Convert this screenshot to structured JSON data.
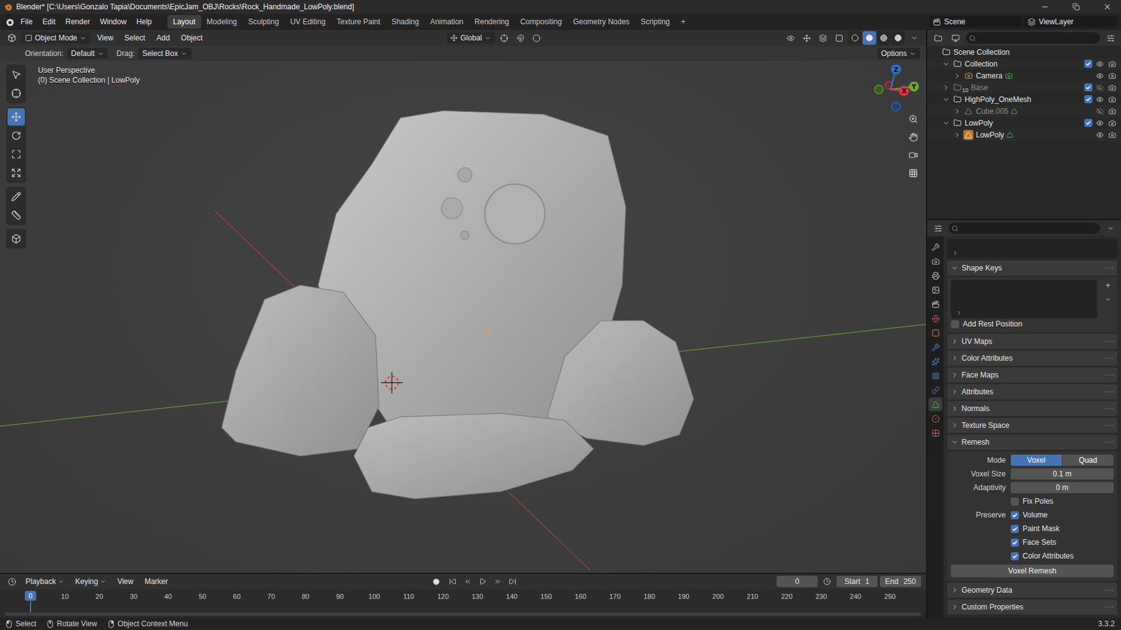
{
  "window": {
    "title": "Blender* [C:\\Users\\Gonzalo Tapia\\Documents\\EpicJam_OBJ\\Rocks\\Rock_Handmade_LowPoly.blend]"
  },
  "menu": [
    "File",
    "Edit",
    "Render",
    "Window",
    "Help"
  ],
  "workspaces": [
    {
      "label": "Layout",
      "selected": true
    },
    {
      "label": "Modeling",
      "selected": false
    },
    {
      "label": "Sculpting",
      "selected": false
    },
    {
      "label": "UV Editing",
      "selected": false
    },
    {
      "label": "Texture Paint",
      "selected": false
    },
    {
      "label": "Shading",
      "selected": false
    },
    {
      "label": "Animation",
      "selected": false
    },
    {
      "label": "Rendering",
      "selected": false
    },
    {
      "label": "Compositing",
      "selected": false
    },
    {
      "label": "Geometry Nodes",
      "selected": false
    },
    {
      "label": "Scripting",
      "selected": false
    }
  ],
  "add_workspace": "+",
  "scene": "Scene",
  "view_layer": "ViewLayer",
  "viewport": {
    "mode": "Object Mode",
    "menus": [
      "View",
      "Select",
      "Add",
      "Object"
    ],
    "transform_orientation": "Global",
    "shading_modes": [
      {
        "kind": "wireframe",
        "selected": false
      },
      {
        "kind": "solid",
        "selected": true
      },
      {
        "kind": "material",
        "selected": false
      },
      {
        "kind": "rendered",
        "selected": false
      }
    ],
    "orientation_label": "Orientation:",
    "orientation": "Default",
    "drag_label": "Drag:",
    "drag": "Select Box",
    "options": "Options",
    "overlay_title": "User Perspective",
    "overlay_subtitle": "(0) Scene Collection | LowPoly",
    "tools": [
      {
        "kind": "select",
        "selected": false,
        "group": 1
      },
      {
        "kind": "cursor",
        "selected": false,
        "group": 1
      },
      {
        "kind": "move",
        "selected": true,
        "group": 2
      },
      {
        "kind": "rotate",
        "selected": false,
        "group": 2
      },
      {
        "kind": "scale",
        "selected": false,
        "group": 2
      },
      {
        "kind": "transform",
        "selected": false,
        "group": 2
      },
      {
        "kind": "annotate",
        "selected": false,
        "group": 3
      },
      {
        "kind": "measure",
        "selected": false,
        "group": 3
      },
      {
        "kind": "add_cube",
        "selected": false,
        "group": 4
      }
    ],
    "gizmo_axes": [
      {
        "label": "Z",
        "color": "#2f6fd6"
      },
      {
        "label": "Y",
        "color": "#6fa82c"
      },
      {
        "label": "X",
        "color": "#e0344a"
      }
    ]
  },
  "outliner": {
    "rows": [
      {
        "label": "Scene Collection",
        "depth": 0,
        "kind": "scene",
        "dimmed": false,
        "active": false
      },
      {
        "label": "Collection",
        "depth": 1,
        "kind": "collection",
        "expanded": true,
        "dimmed": false,
        "checked": true,
        "visible": true,
        "active": false
      },
      {
        "label": "Camera",
        "depth": 2,
        "kind": "camera",
        "expanded": false,
        "dimmed": false,
        "visible": true,
        "active": false
      },
      {
        "label": "Base",
        "depth": 1,
        "kind": "collection",
        "expanded": false,
        "dimmed": true,
        "checked": true,
        "visible": false,
        "badge": "10",
        "active": false
      },
      {
        "label": "HighPoly_OneMesh",
        "depth": 1,
        "kind": "collection",
        "expanded": true,
        "dimmed": false,
        "checked": true,
        "visible": true,
        "active": false
      },
      {
        "label": "Cube.005",
        "depth": 2,
        "kind": "mesh",
        "expanded": false,
        "dimmed": true,
        "visible": false,
        "active": false
      },
      {
        "label": "LowPoly",
        "depth": 1,
        "kind": "collection",
        "expanded": true,
        "dimmed": false,
        "checked": true,
        "visible": true,
        "active": false
      },
      {
        "label": "LowPoly",
        "depth": 2,
        "kind": "mesh",
        "expanded": false,
        "dimmed": false,
        "visible": true,
        "active": true
      }
    ]
  },
  "properties": {
    "tabs": [
      {
        "kind": "tool",
        "selected": false
      },
      {
        "kind": "render",
        "selected": false
      },
      {
        "kind": "output",
        "selected": false
      },
      {
        "kind": "view_layer",
        "selected": false
      },
      {
        "kind": "scene",
        "selected": false
      },
      {
        "kind": "world",
        "selected": false
      },
      {
        "kind": "object",
        "selected": false
      },
      {
        "kind": "modifiers",
        "selected": false
      },
      {
        "kind": "particles",
        "selected": false
      },
      {
        "kind": "physics",
        "selected": false
      },
      {
        "kind": "constraints",
        "selected": false
      },
      {
        "kind": "data",
        "selected": true
      },
      {
        "kind": "material",
        "selected": false
      },
      {
        "kind": "texture",
        "selected": false
      }
    ],
    "shape_keys": {
      "label": "Shape Keys",
      "expanded": true,
      "add_button": "+",
      "add_rest_position": {
        "label": "Add Rest Position",
        "checked": false
      }
    },
    "collapsed_panels": [
      {
        "label": "UV Maps",
        "expanded": false
      },
      {
        "label": "Color Attributes",
        "expanded": false
      },
      {
        "label": "Face Maps",
        "expanded": false
      },
      {
        "label": "Attributes",
        "expanded": false
      },
      {
        "label": "Normals",
        "expanded": false
      },
      {
        "label": "Texture Space",
        "expanded": false
      }
    ],
    "remesh": {
      "label": "Remesh",
      "expanded": true,
      "mode_label": "Mode",
      "modes": [
        {
          "label": "Voxel",
          "selected": true
        },
        {
          "label": "Quad",
          "selected": false
        }
      ],
      "fields": [
        {
          "label": "Voxel Size",
          "value": "0.1 m"
        },
        {
          "label": "Adaptivity",
          "value": "0 m"
        }
      ],
      "fix_poles": {
        "label": "Fix Poles",
        "checked": false
      },
      "preserve_label": "Preserve",
      "preserve": [
        {
          "label": "Volume",
          "checked": true
        },
        {
          "label": "Paint Mask",
          "checked": true
        },
        {
          "label": "Face Sets",
          "checked": true
        },
        {
          "label": "Color Attributes",
          "checked": true
        }
      ],
      "button": "Voxel Remesh"
    },
    "bottom_panels": [
      {
        "label": "Geometry Data",
        "expanded": false
      },
      {
        "label": "Custom Properties",
        "expanded": false
      }
    ]
  },
  "timeline": {
    "menus": [
      "Playback",
      "Keying",
      "View",
      "Marker"
    ],
    "current_frame": "0",
    "start_label": "Start",
    "start": "1",
    "end_label": "End",
    "end": "250",
    "playhead": "0",
    "ticks": [
      "10",
      "20",
      "30",
      "40",
      "50",
      "60",
      "70",
      "80",
      "90",
      "100",
      "110",
      "120",
      "130",
      "140",
      "150",
      "160",
      "170",
      "180",
      "190",
      "200",
      "210",
      "220",
      "230",
      "240",
      "250"
    ]
  },
  "status_bar": {
    "items": [
      "Select",
      "Rotate View",
      "Object Context Menu"
    ],
    "version": "3.3.2"
  }
}
